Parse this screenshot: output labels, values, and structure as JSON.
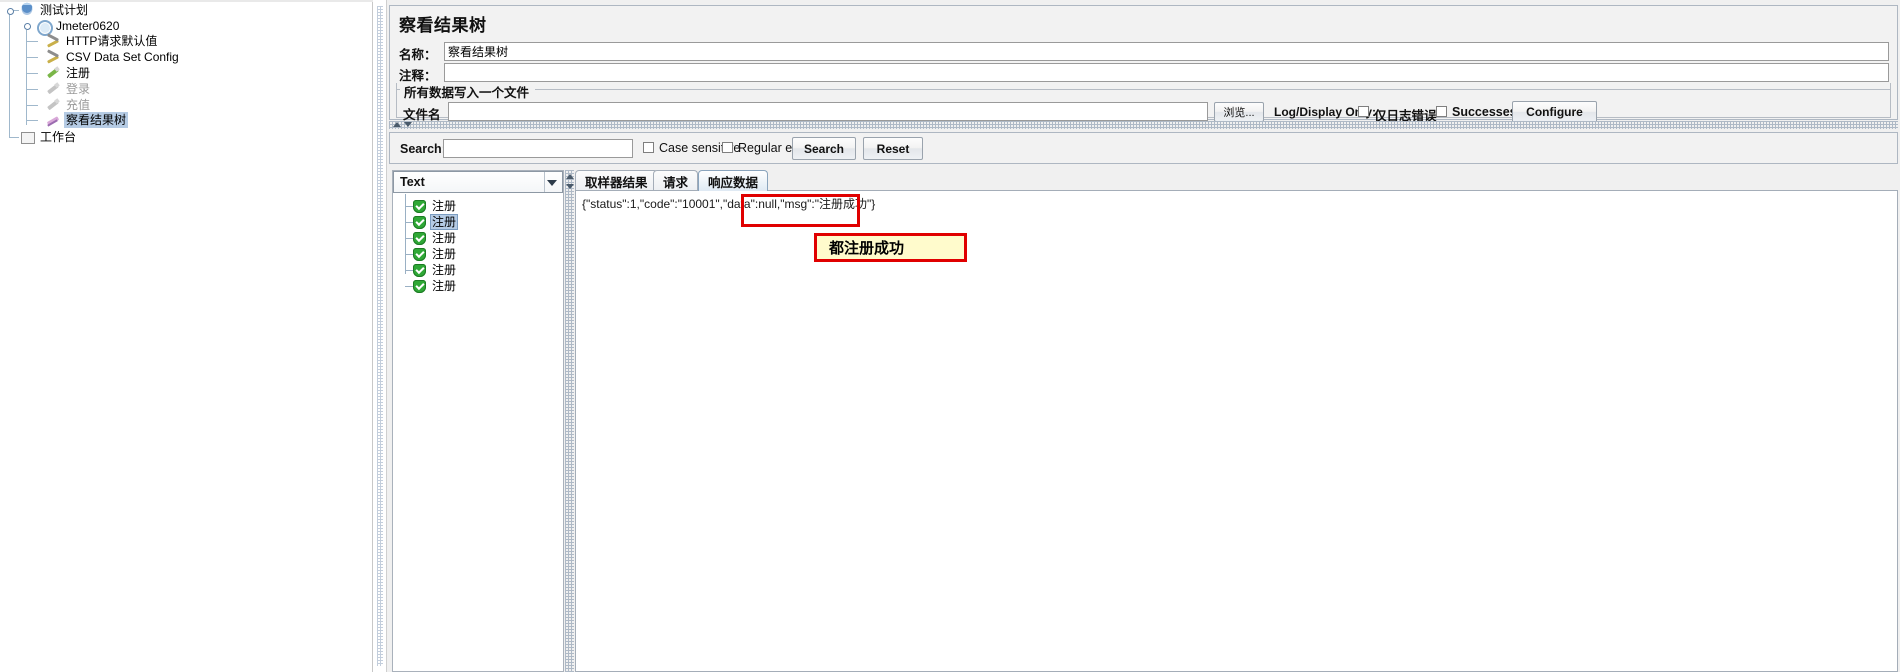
{
  "tree": {
    "nodes": [
      {
        "label": "测试计划",
        "icon": "test-plan-icon",
        "depth": 0,
        "state": "normal"
      },
      {
        "label": "Jmeter0620",
        "icon": "thread-group-icon",
        "depth": 1,
        "state": "normal"
      },
      {
        "label": "HTTP请求默认值",
        "icon": "config-element-icon",
        "depth": 2,
        "state": "normal"
      },
      {
        "label": "CSV Data Set Config",
        "icon": "config-element-icon",
        "depth": 2,
        "state": "normal"
      },
      {
        "label": "注册",
        "icon": "http-sampler-icon",
        "depth": 2,
        "state": "normal"
      },
      {
        "label": "登录",
        "icon": "http-sampler-icon",
        "depth": 2,
        "state": "disabled"
      },
      {
        "label": "充值",
        "icon": "http-sampler-icon",
        "depth": 2,
        "state": "disabled"
      },
      {
        "label": "察看结果树",
        "icon": "view-results-tree-icon",
        "depth": 2,
        "state": "selected"
      },
      {
        "label": "工作台",
        "icon": "workbench-icon",
        "depth": 0,
        "state": "normal"
      }
    ]
  },
  "panel": {
    "title": "察看结果树",
    "name_label": "名称：",
    "name_value": "察看结果树",
    "comment_label": "注释：",
    "comment_value": "",
    "file_group_title": "所有数据写入一个文件",
    "filename_label": "文件名",
    "filename_value": "",
    "browse_button": "浏览...",
    "log_display_label": "Log/Display Only:",
    "errors_checkbox_label": "仅日志错误",
    "errors_checked": false,
    "successes_checkbox_label": "Successes",
    "successes_checked": false,
    "configure_button": "Configure"
  },
  "search": {
    "label": "Search:",
    "value": "",
    "case_sensitive_label": "Case sensitive",
    "case_sensitive_checked": false,
    "regular_exp_label": "Regular exp.",
    "regular_exp_checked": false,
    "search_button": "Search",
    "reset_button": "Reset"
  },
  "results": {
    "renderer_selected": "Text",
    "items": [
      {
        "label": "注册",
        "status": "success",
        "selected": false
      },
      {
        "label": "注册",
        "status": "success",
        "selected": true
      },
      {
        "label": "注册",
        "status": "success",
        "selected": false
      },
      {
        "label": "注册",
        "status": "success",
        "selected": false
      },
      {
        "label": "注册",
        "status": "success",
        "selected": false
      },
      {
        "label": "注册",
        "status": "success",
        "selected": false
      }
    ]
  },
  "tabs": [
    {
      "label": "取样器结果",
      "active": false
    },
    {
      "label": "请求",
      "active": false
    },
    {
      "label": "响应数据",
      "active": true
    }
  ],
  "response": {
    "text": "{\"status\":1,\"code\":\"10001\",\"data\":null,\"msg\":\"注册成功\"}"
  },
  "annotations": {
    "callout_text": "都注册成功",
    "box_color": "#e00000",
    "callout_bg": "#fffbcc"
  }
}
